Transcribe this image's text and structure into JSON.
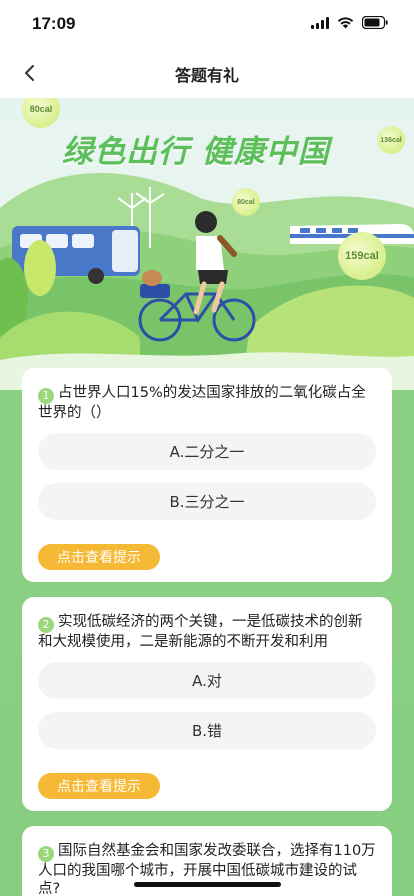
{
  "status_bar": {
    "time": "17:09"
  },
  "nav": {
    "title": "答题有礼",
    "back_icon": "chevron-left-icon"
  },
  "banner": {
    "title": "绿色出行 健康中国",
    "calories": [
      "80cal",
      "136cal",
      "80cal",
      "159cal"
    ]
  },
  "questions": [
    {
      "number": "1",
      "text": "占世界人口15%的发达国家排放的二氧化碳占全世界的（）",
      "options": [
        "A.二分之一",
        "B.三分之一"
      ],
      "hint_label": "点击查看提示"
    },
    {
      "number": "2",
      "text": "实现低碳经济的两个关键，一是低碳技术的创新和大规模使用，二是新能源的不断开发和利用",
      "options": [
        "A.对",
        "B.错"
      ],
      "hint_label": "点击查看提示"
    },
    {
      "number": "3",
      "text": "国际自然基金会和国家发改委联合，选择有110万人口的我国哪个城市，开展中国低碳城市建设的试点?"
    }
  ],
  "colors": {
    "accent_green": "#5dbf5b",
    "background_green": "#8bd083",
    "hint_button": "#f6b935"
  }
}
